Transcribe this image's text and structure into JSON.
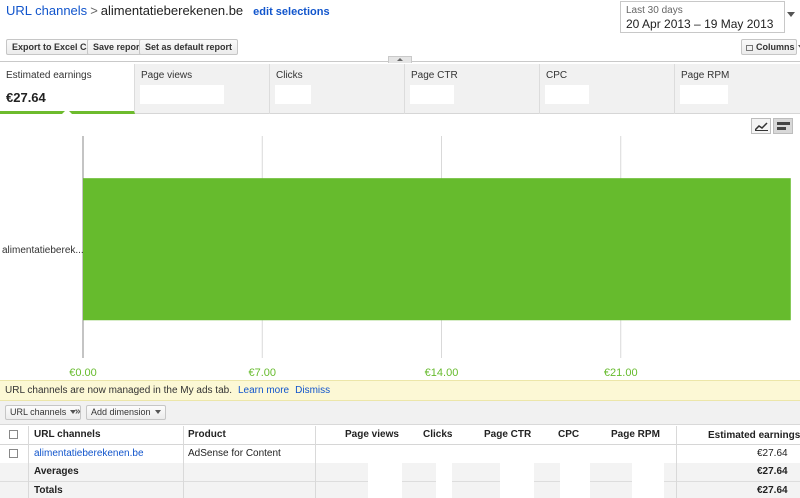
{
  "header": {
    "breadcrumb_root": "URL channels",
    "breadcrumb_sep": ">",
    "breadcrumb_site": "alimentatieberekenen.be",
    "edit_label": "edit selections"
  },
  "daterange": {
    "label": "Last 30 days",
    "value": "20 Apr 2013 – 19 May 2013"
  },
  "toolbar": {
    "export": "Export to Excel CSV",
    "save": "Save report",
    "default": "Set as default report",
    "columns": "Columns"
  },
  "metrics": [
    {
      "name": "Estimated earnings",
      "value": "€27.64"
    },
    {
      "name": "Page views",
      "value": ""
    },
    {
      "name": "Clicks",
      "value": ""
    },
    {
      "name": "Page CTR",
      "value": ""
    },
    {
      "name": "CPC",
      "value": ""
    },
    {
      "name": "Page RPM",
      "value": ""
    }
  ],
  "chart_data": {
    "type": "bar",
    "orientation": "horizontal",
    "categories": [
      "alimentatieberek..."
    ],
    "values": [
      27.64
    ],
    "xticks": [
      "€0.00",
      "€7.00",
      "€14.00",
      "€21.00"
    ],
    "xlim": [
      0,
      28
    ],
    "grid": true,
    "bar_color": "#66bb2d",
    "tick_color": "#66bb2d"
  },
  "notice": {
    "text": "URL channels are now managed in the My ads tab.",
    "learn_more": "Learn more",
    "dismiss": "Dismiss"
  },
  "dimbar": {
    "dimension": "URL channels",
    "chevron": "»",
    "add": "Add dimension"
  },
  "table": {
    "headers": {
      "dimension": "URL channels",
      "product": "Product",
      "page_views": "Page views",
      "clicks": "Clicks",
      "page_ctr": "Page CTR",
      "cpc": "CPC",
      "page_rpm": "Page RPM",
      "earnings": "Estimated earnings"
    },
    "sort_indicator": "↓",
    "rows": [
      {
        "dimension": "alimentatieberekenen.be",
        "product": "AdSense for Content",
        "earnings": "€27.64"
      }
    ],
    "averages": {
      "label": "Averages",
      "earnings": "€27.64"
    },
    "totals": {
      "label": "Totals",
      "earnings": "€27.64"
    }
  }
}
